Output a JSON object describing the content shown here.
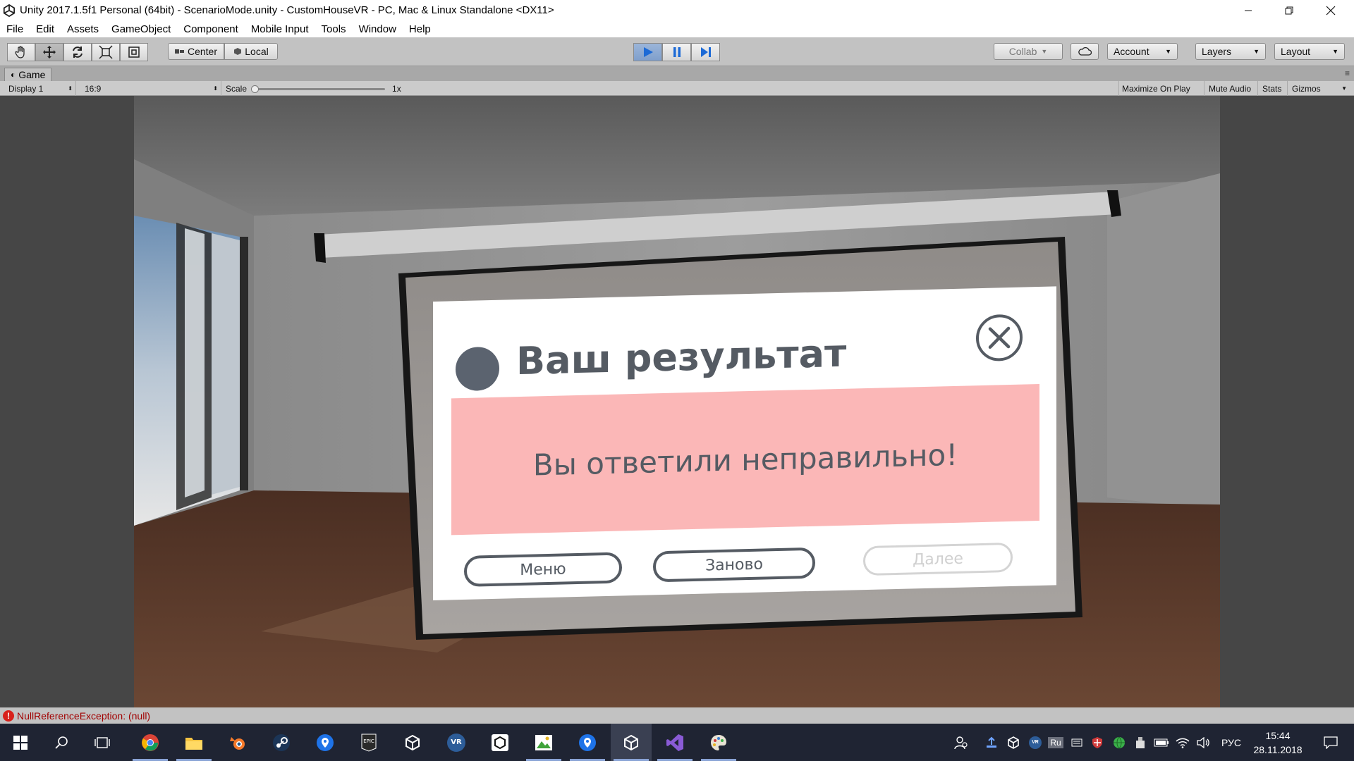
{
  "window": {
    "title": "Unity 2017.1.5f1 Personal (64bit) - ScenarioMode.unity - CustomHouseVR - PC, Mac & Linux Standalone <DX11>"
  },
  "menu": [
    "File",
    "Edit",
    "Assets",
    "GameObject",
    "Component",
    "Mobile Input",
    "Tools",
    "Window",
    "Help"
  ],
  "toolbar": {
    "center_label": "Center",
    "local_label": "Local",
    "collab_label": "Collab",
    "account_label": "Account",
    "layers_label": "Layers",
    "layout_label": "Layout"
  },
  "game_tab": {
    "tab_label": "Game",
    "display": "Display 1",
    "aspect": "16:9",
    "scale_label": "Scale",
    "scale_value": "1x",
    "maximize_on_play": "Maximize On Play",
    "mute_audio": "Mute Audio",
    "stats": "Stats",
    "gizmos": "Gizmos"
  },
  "dialog": {
    "title": "Ваш результат",
    "message": "Вы ответили неправильно!",
    "btn_menu": "Меню",
    "btn_retry": "Заново",
    "btn_next": "Далее"
  },
  "status": {
    "message": "NullReferenceException: (null)"
  },
  "taskbar": {
    "language": "РУС",
    "input_lang": "Ru",
    "vr_label": "VR",
    "time": "15:44",
    "date": "28.11.2018"
  }
}
